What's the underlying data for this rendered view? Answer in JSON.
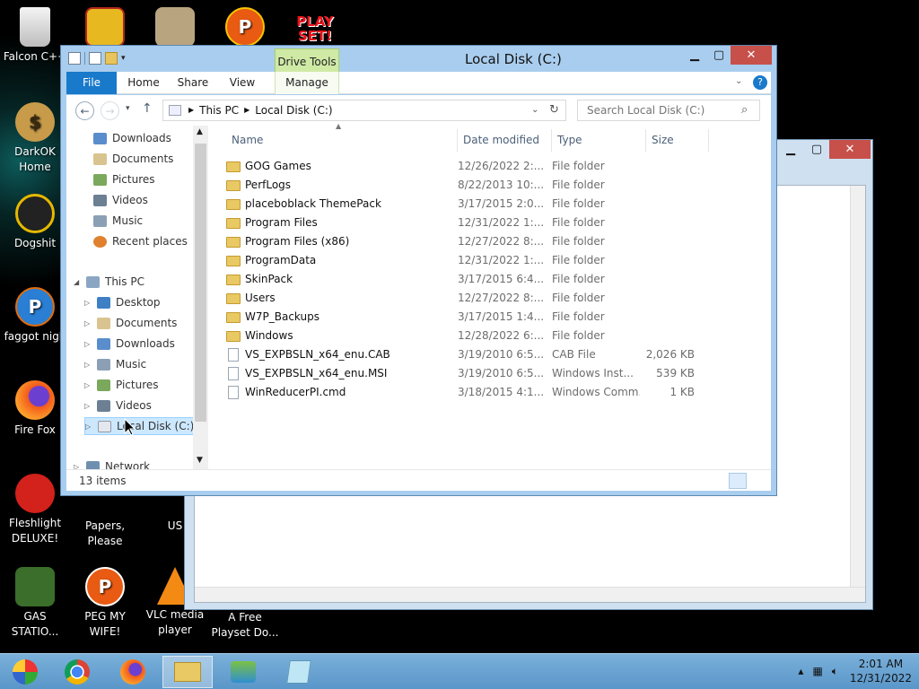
{
  "desktop": {
    "icons": [
      {
        "label": "Falcon C++"
      },
      {
        "label": "DarkOK Home"
      },
      {
        "label": "Dogshit"
      },
      {
        "label": "faggot nigh"
      },
      {
        "label": "Fire Fox"
      },
      {
        "label": "Fleshlight DELUXE!"
      },
      {
        "label": "Papers, Please"
      },
      {
        "label": "US"
      },
      {
        "label": "GAS STATIO..."
      },
      {
        "label": "PEG MY WIFE!"
      },
      {
        "label": "VLC media player"
      },
      {
        "label": "A Free Playset Do..."
      }
    ],
    "top_icon_text": "PLAY SET!"
  },
  "window": {
    "title": "Local Disk (C:)",
    "contextual_tab": "Drive Tools",
    "tabs": [
      "File",
      "Home",
      "Share",
      "View",
      "Manage"
    ],
    "breadcrumb": [
      "This PC",
      "Local Disk (C:)"
    ],
    "search_placeholder": "Search Local Disk (C:)",
    "status": "13 items"
  },
  "nav_pane": {
    "quick_access": [
      "Downloads",
      "Documents",
      "Pictures",
      "Videos",
      "Music",
      "Recent places"
    ],
    "this_pc": "This PC",
    "this_pc_children": [
      "Desktop",
      "Documents",
      "Downloads",
      "Music",
      "Pictures",
      "Videos",
      "Local Disk (C:)"
    ],
    "network": "Network"
  },
  "columns": {
    "name": "Name",
    "date": "Date modified",
    "type": "Type",
    "size": "Size"
  },
  "files": [
    {
      "name": "GOG Games",
      "date": "12/26/2022 2:...",
      "type": "File folder",
      "size": "",
      "kind": "folder"
    },
    {
      "name": "PerfLogs",
      "date": "8/22/2013 10:...",
      "type": "File folder",
      "size": "",
      "kind": "folder"
    },
    {
      "name": "placeboblack ThemePack",
      "date": "3/17/2015 2:0...",
      "type": "File folder",
      "size": "",
      "kind": "folder"
    },
    {
      "name": "Program Files",
      "date": "12/31/2022 1:...",
      "type": "File folder",
      "size": "",
      "kind": "folder"
    },
    {
      "name": "Program Files (x86)",
      "date": "12/27/2022 8:...",
      "type": "File folder",
      "size": "",
      "kind": "folder"
    },
    {
      "name": "ProgramData",
      "date": "12/31/2022 1:...",
      "type": "File folder",
      "size": "",
      "kind": "folder"
    },
    {
      "name": "SkinPack",
      "date": "3/17/2015 6:4...",
      "type": "File folder",
      "size": "",
      "kind": "folder"
    },
    {
      "name": "Users",
      "date": "12/27/2022 8:...",
      "type": "File folder",
      "size": "",
      "kind": "folder"
    },
    {
      "name": "W7P_Backups",
      "date": "3/17/2015 1:4...",
      "type": "File folder",
      "size": "",
      "kind": "folder"
    },
    {
      "name": "Windows",
      "date": "12/28/2022 6:...",
      "type": "File folder",
      "size": "",
      "kind": "folder"
    },
    {
      "name": "VS_EXPBSLN_x64_enu.CAB",
      "date": "3/19/2010 6:5...",
      "type": "CAB File",
      "size": "2,026 KB",
      "kind": "file"
    },
    {
      "name": "VS_EXPBSLN_x64_enu.MSI",
      "date": "3/19/2010 6:5...",
      "type": "Windows Inst...",
      "size": "539 KB",
      "kind": "file"
    },
    {
      "name": "WinReducerPI.cmd",
      "date": "3/18/2015 4:1...",
      "type": "Windows Comm...",
      "size": "1 KB",
      "kind": "file"
    }
  ],
  "taskbar": {
    "time": "2:01 AM",
    "date": "12/31/2022"
  }
}
